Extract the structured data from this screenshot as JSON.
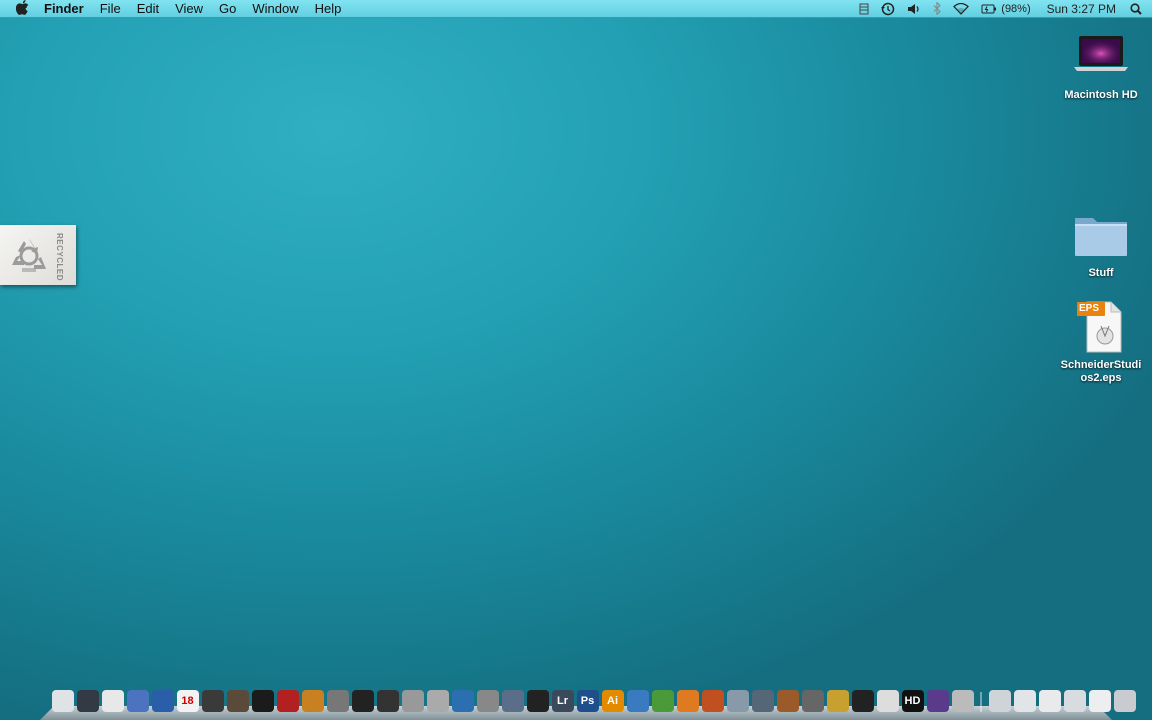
{
  "menubar": {
    "apple": "",
    "app": "Finder",
    "menus": [
      "File",
      "Edit",
      "View",
      "Go",
      "Window",
      "Help"
    ],
    "battery": "(98%)",
    "clock": "Sun 3:27 PM"
  },
  "desktop": {
    "icons": [
      {
        "label": "Macintosh HD",
        "icon": "hard-drive-icon"
      },
      {
        "label": "Stuff",
        "icon": "folder-icon"
      },
      {
        "label": "SchneiderStudios2.eps",
        "badge": "EPS",
        "icon": "eps-file-icon"
      }
    ],
    "tag_text": "RECYCLED"
  },
  "dock": {
    "items": [
      {
        "icon": "finder-icon",
        "color": "#dfe3e6",
        "text": ""
      },
      {
        "icon": "dashboard-icon",
        "color": "#333a44",
        "text": ""
      },
      {
        "icon": "gmail-icon",
        "color": "#e8e8e8",
        "text": ""
      },
      {
        "icon": "mail-icon",
        "color": "#4b73c0",
        "text": ""
      },
      {
        "icon": "firefox-icon",
        "color": "#2a5ea8",
        "text": ""
      },
      {
        "icon": "ical-icon",
        "color": "#f2f2f2",
        "text": "18"
      },
      {
        "icon": "video-icon",
        "color": "#3a3a3a",
        "text": ""
      },
      {
        "icon": "tool-icon",
        "color": "#5a4a3a",
        "text": ""
      },
      {
        "icon": "monitor-icon",
        "color": "#1b1b1b",
        "text": ""
      },
      {
        "icon": "red-icon",
        "color": "#b22020",
        "text": ""
      },
      {
        "icon": "film-icon",
        "color": "#c88020",
        "text": ""
      },
      {
        "icon": "globe-icon",
        "color": "#777",
        "text": ""
      },
      {
        "icon": "clapper-icon",
        "color": "#222",
        "text": ""
      },
      {
        "icon": "clapper2-icon",
        "color": "#333",
        "text": ""
      },
      {
        "icon": "tubes-icon",
        "color": "#999",
        "text": ""
      },
      {
        "icon": "pencil-icon",
        "color": "#aaa",
        "text": ""
      },
      {
        "icon": "quill-icon",
        "color": "#2c6fb0",
        "text": ""
      },
      {
        "icon": "disc-icon",
        "color": "#888",
        "text": ""
      },
      {
        "icon": "image-icon",
        "color": "#5a6e8a",
        "text": ""
      },
      {
        "icon": "dvd-icon",
        "color": "#222",
        "text": ""
      },
      {
        "icon": "lightroom-icon",
        "color": "#3b4a5a",
        "text": "Lr"
      },
      {
        "icon": "photoshop-icon",
        "color": "#1e4e8c",
        "text": "Ps"
      },
      {
        "icon": "illustrator-icon",
        "color": "#e38a00",
        "text": "Ai"
      },
      {
        "icon": "w-icon",
        "color": "#3a7ac0",
        "text": ""
      },
      {
        "icon": "plant-icon",
        "color": "#4a9a3a",
        "text": ""
      },
      {
        "icon": "p-icon",
        "color": "#e07a20",
        "text": ""
      },
      {
        "icon": "stamp-icon",
        "color": "#c05020",
        "text": ""
      },
      {
        "icon": "rocket-icon",
        "color": "#8899aa",
        "text": ""
      },
      {
        "icon": "plane-icon",
        "color": "#556677",
        "text": ""
      },
      {
        "icon": "barrel-icon",
        "color": "#9a5a2a",
        "text": ""
      },
      {
        "icon": "gun-icon",
        "color": "#666",
        "text": ""
      },
      {
        "icon": "bird-icon",
        "color": "#c8a030",
        "text": ""
      },
      {
        "icon": "pirate-icon",
        "color": "#222",
        "text": ""
      },
      {
        "icon": "bulb-icon",
        "color": "#ddd",
        "text": ""
      },
      {
        "icon": "hd-icon",
        "color": "#111",
        "text": "HD"
      },
      {
        "icon": "orb-icon",
        "color": "#5a3a8a",
        "text": ""
      },
      {
        "icon": "settings-icon",
        "color": "#bbb",
        "text": ""
      }
    ],
    "stacks": [
      {
        "icon": "stack-icon",
        "color": "#cfd4d8"
      },
      {
        "icon": "stack-icon",
        "color": "#e2e5e8"
      },
      {
        "icon": "stack-icon",
        "color": "#e8eaec"
      },
      {
        "icon": "stack-icon",
        "color": "#d8dce0"
      },
      {
        "icon": "stack-icon",
        "color": "#eceef0"
      },
      {
        "icon": "trash-icon",
        "color": "#c8ccd0"
      }
    ]
  }
}
